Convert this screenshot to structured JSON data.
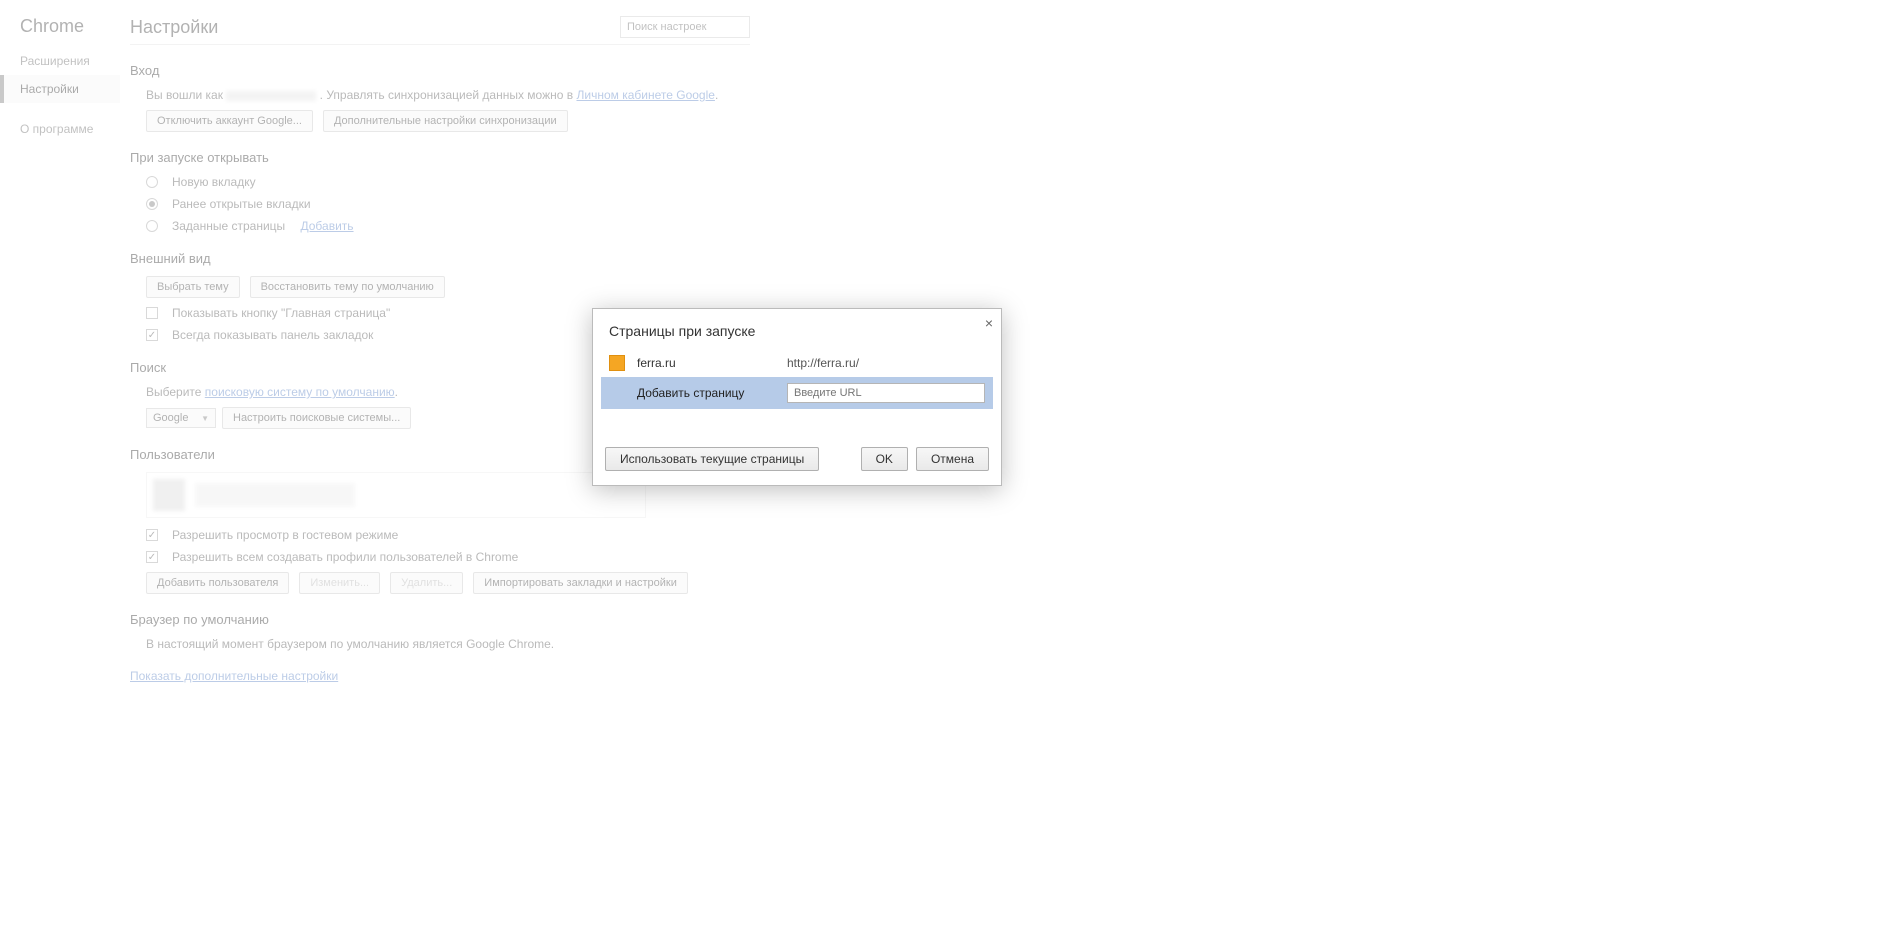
{
  "sidebar": {
    "title": "Chrome",
    "items": [
      {
        "label": "Расширения"
      },
      {
        "label": "Настройки"
      },
      {
        "label": "О программе"
      }
    ]
  },
  "header": {
    "title": "Настройки",
    "search_placeholder": "Поиск настроек"
  },
  "login": {
    "heading": "Вход",
    "prefix": "Вы вошли как",
    "mid_text": ". Управлять синхронизацией данных можно в ",
    "link": "Личном кабинете Google",
    "suffix": ".",
    "btn_disconnect": "Отключить аккаунт Google...",
    "btn_sync": "Дополнительные настройки синхронизации"
  },
  "startup": {
    "heading": "При запуске открывать",
    "opt_new": "Новую вкладку",
    "opt_prev": "Ранее открытые вкладки",
    "opt_pages": "Заданные страницы",
    "add_link": "Добавить"
  },
  "appearance": {
    "heading": "Внешний вид",
    "btn_theme": "Выбрать тему",
    "btn_reset_theme": "Восстановить тему по умолчанию",
    "chk_home": "Показывать кнопку \"Главная страница\"",
    "chk_bookmarks": "Всегда показывать панель закладок"
  },
  "search": {
    "heading": "Поиск",
    "prefix": "Выберите ",
    "link": "поисковую систему по умолчанию",
    "suffix": ".",
    "engine": "Google",
    "btn_manage": "Настроить поисковые системы..."
  },
  "users": {
    "heading": "Пользователи",
    "chk_guest": "Разрешить просмотр в гостевом режиме",
    "chk_anyone": "Разрешить всем создавать профили пользователей в Chrome",
    "btn_add": "Добавить пользователя",
    "btn_edit": "Изменить...",
    "btn_delete": "Удалить...",
    "btn_import": "Импортировать закладки и настройки"
  },
  "default_browser": {
    "heading": "Браузер по умолчанию",
    "text": "В настоящий момент браузером по умолчанию является Google Chrome."
  },
  "advanced_link": "Показать дополнительные настройки",
  "modal": {
    "title": "Страницы при запуске",
    "row_name": "ferra.ru",
    "row_url": "http://ferra.ru/",
    "add_label": "Добавить страницу",
    "url_placeholder": "Введите URL",
    "btn_current": "Использовать текущие страницы",
    "btn_ok": "OK",
    "btn_cancel": "Отмена"
  }
}
